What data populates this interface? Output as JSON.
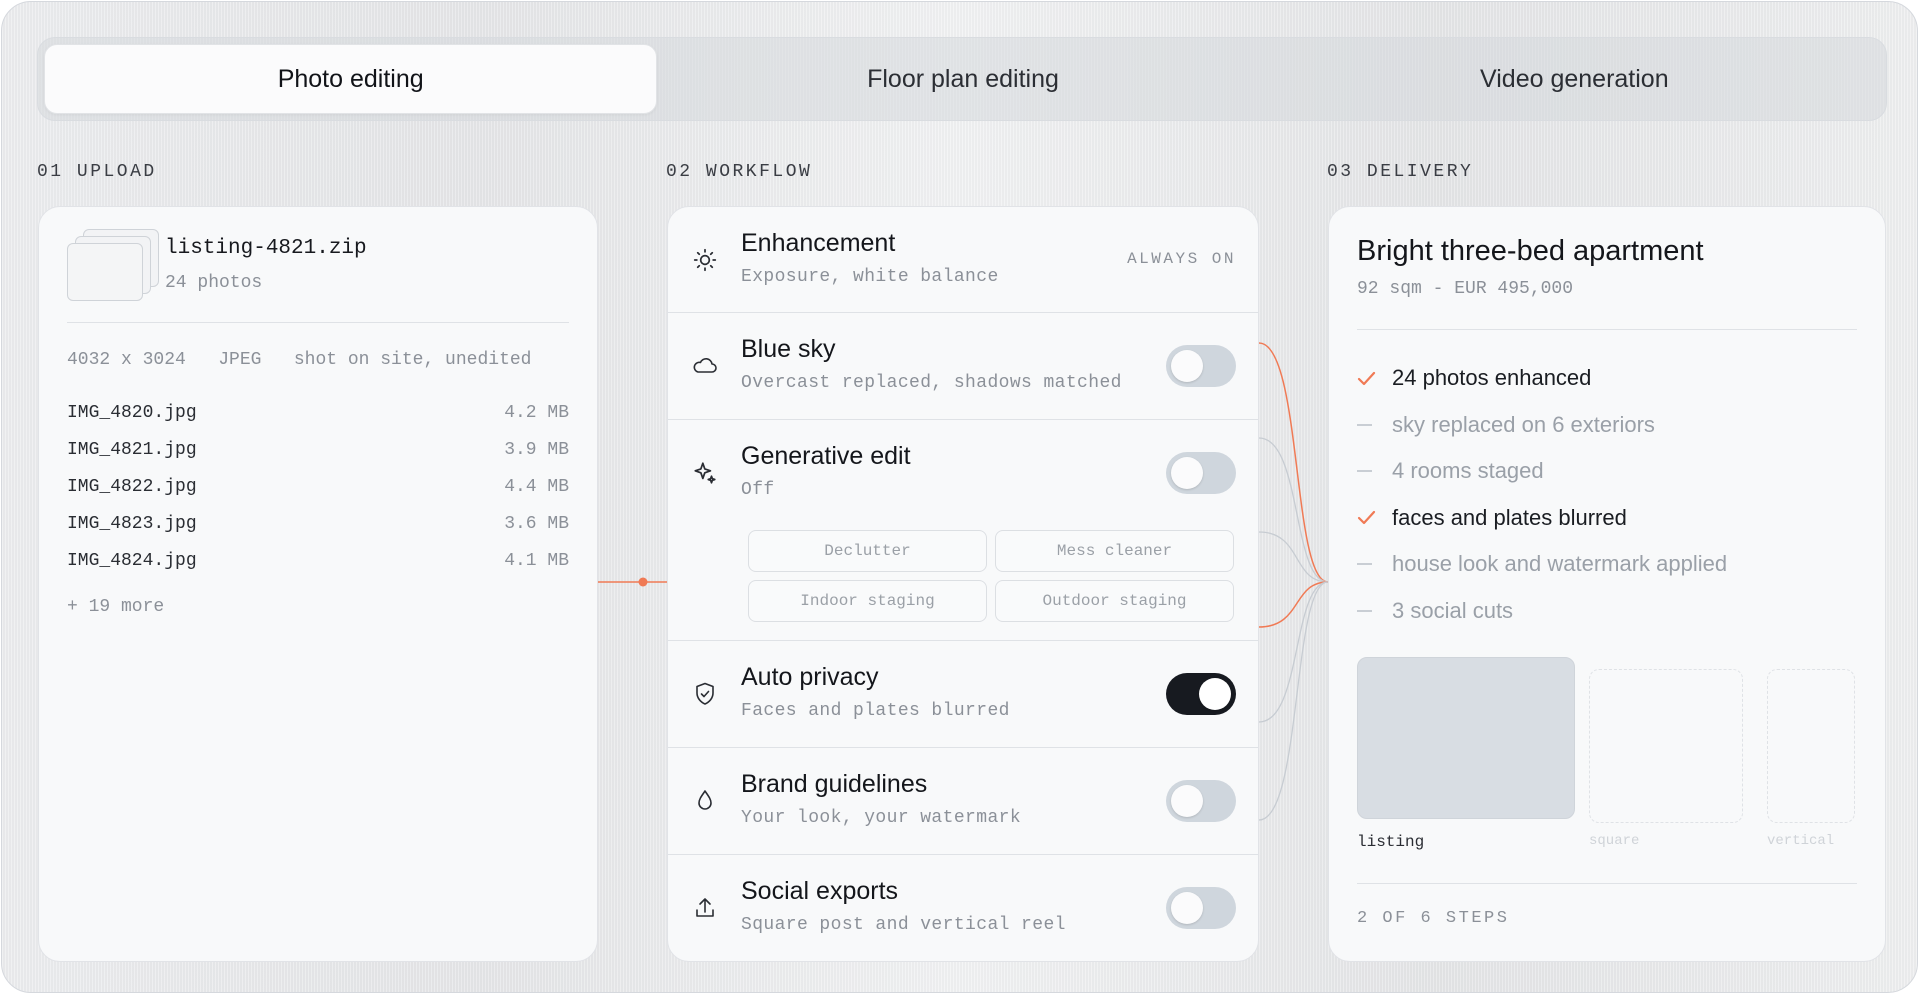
{
  "tabs": [
    {
      "label": "Photo editing",
      "active": true
    },
    {
      "label": "Floor plan editing",
      "active": false
    },
    {
      "label": "Video generation",
      "active": false
    }
  ],
  "sections": {
    "upload": "01 UPLOAD",
    "workflow": "02 WORKFLOW",
    "delivery": "03 DELIVERY"
  },
  "upload": {
    "archive_name": "listing-4821.zip",
    "photo_count": "24 photos",
    "meta": "4032 x 3024   JPEG   shot on site, unedited",
    "files": [
      {
        "name": "IMG_4820.jpg",
        "size": "4.2 MB"
      },
      {
        "name": "IMG_4821.jpg",
        "size": "3.9 MB"
      },
      {
        "name": "IMG_4822.jpg",
        "size": "4.4 MB"
      },
      {
        "name": "IMG_4823.jpg",
        "size": "3.6 MB"
      },
      {
        "name": "IMG_4824.jpg",
        "size": "4.1 MB"
      }
    ],
    "more": "+ 19 more"
  },
  "workflow": {
    "steps": [
      {
        "title": "Enhancement",
        "subtitle": "Exposure, white balance",
        "status": "ALWAYS ON",
        "icon": "sun-icon"
      },
      {
        "title": "Blue sky",
        "subtitle": "Overcast replaced, shadows matched",
        "toggle": false,
        "icon": "cloud-icon"
      },
      {
        "title": "Generative edit",
        "subtitle": "Off",
        "toggle": false,
        "icon": "sparkle-icon",
        "options": [
          "Declutter",
          "Mess cleaner",
          "Indoor staging",
          "Outdoor staging"
        ]
      },
      {
        "title": "Auto privacy",
        "subtitle": "Faces and plates blurred",
        "toggle": true,
        "icon": "shield-icon"
      },
      {
        "title": "Brand guidelines",
        "subtitle": "Your look, your watermark",
        "toggle": false,
        "icon": "droplet-icon"
      },
      {
        "title": "Social exports",
        "subtitle": "Square post and vertical reel",
        "toggle": false,
        "icon": "upload-icon"
      }
    ]
  },
  "delivery": {
    "title": "Bright three-bed apartment",
    "subtitle": "92 sqm - EUR 495,000",
    "checklist": [
      {
        "label": "24 photos enhanced",
        "done": true
      },
      {
        "label": "sky replaced on 6 exteriors",
        "done": false
      },
      {
        "label": "4 rooms staged",
        "done": false
      },
      {
        "label": "faces and plates blurred",
        "done": true
      },
      {
        "label": "house look and watermark applied",
        "done": false
      },
      {
        "label": "3 social cuts",
        "done": false
      }
    ],
    "formats": [
      {
        "label": "listing",
        "ready": true
      },
      {
        "label": "square",
        "ready": false
      },
      {
        "label": "vertical",
        "ready": false
      }
    ],
    "progress": "2 OF 6 STEPS"
  },
  "colors": {
    "accent": "#f07a55",
    "connector_gray": "#c7ccd2",
    "toggle_off": "#cfd6dd",
    "toggle_on": "#171a20"
  }
}
